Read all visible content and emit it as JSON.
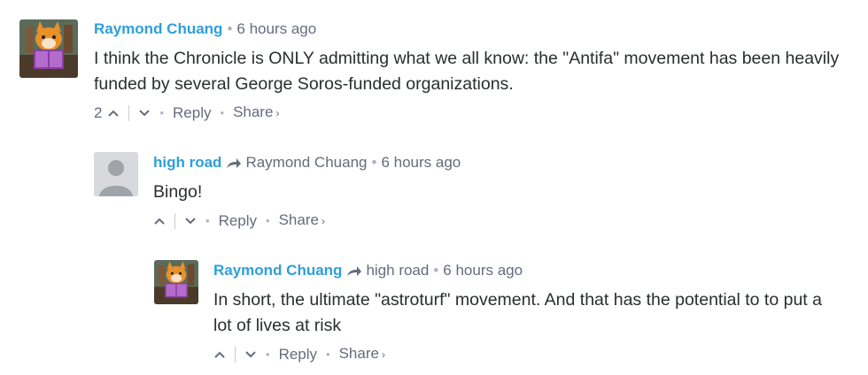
{
  "comments": [
    {
      "author": "Raymond Chuang",
      "time": "6 hours ago",
      "text": "I think the Chronicle is ONLY admitting what we all know: the \"Antifa\" movement has been heavily funded by several George Soros-funded organizations.",
      "votes": "2",
      "reply_label": "Reply",
      "share_label": "Share"
    },
    {
      "author": "high road",
      "reply_to": "Raymond Chuang",
      "time": "6 hours ago",
      "text": "Bingo!",
      "reply_label": "Reply",
      "share_label": "Share"
    },
    {
      "author": "Raymond Chuang",
      "reply_to": "high road",
      "time": "6 hours ago",
      "text": "In short, the ultimate \"astroturf\" movement. And that has the potential to to put a lot of lives at risk",
      "reply_label": "Reply",
      "share_label": "Share"
    }
  ],
  "colors": {
    "author": "#2e9fda",
    "meta": "#656c7a",
    "text": "#2a2e2e"
  },
  "icons": {
    "upvote": "chevron-up-icon",
    "downvote": "chevron-down-icon",
    "reply_arrow": "reply-arrow-icon",
    "share_caret": "chevron-right-icon"
  }
}
